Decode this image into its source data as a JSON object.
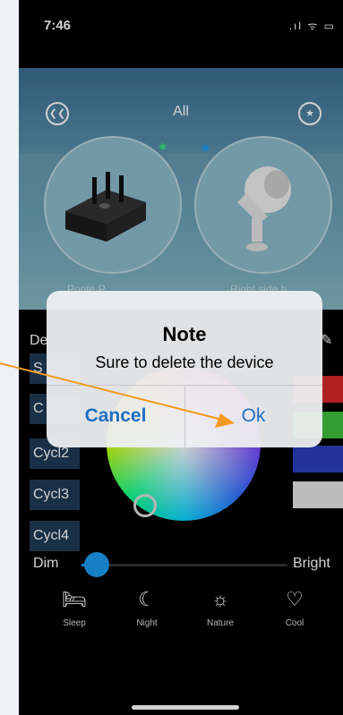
{
  "status": {
    "time": "7:46",
    "icons": ".ıl ᯤ ▭"
  },
  "header": {
    "title": "All",
    "left_icon": "double-leaf-icon",
    "right_icon": "star-icon"
  },
  "devices": [
    {
      "name": "Ponte P...",
      "icon": "hub-device-icon"
    },
    {
      "name": "Right side h...",
      "icon": "spotlight-icon"
    }
  ],
  "side_label_left": "De",
  "cycles": [
    "S",
    "C",
    "Cycl2",
    "Cycl3",
    "Cycl4"
  ],
  "swatch_colors": [
    "#d82a2a",
    "#3fbf3f",
    "#2b3fbf",
    "#e6e6e6"
  ],
  "slider": {
    "min_label": "Dim",
    "max_label": "Bright",
    "value": 0.02
  },
  "scenes": [
    {
      "label": "Sleep",
      "icon": "bed-icon"
    },
    {
      "label": "Night",
      "icon": "moon-icon"
    },
    {
      "label": "Nature",
      "icon": "sun-icon"
    },
    {
      "label": "Cool",
      "icon": "snowflake-icon"
    }
  ],
  "dialog": {
    "title": "Note",
    "message": "Sure to delete the device",
    "cancel_label": "Cancel",
    "ok_label": "Ok"
  },
  "accent_color": "#1d9bf0",
  "dialog_button_color": "#1e6fc3",
  "annotation_arrow_color": "#f39a1e"
}
